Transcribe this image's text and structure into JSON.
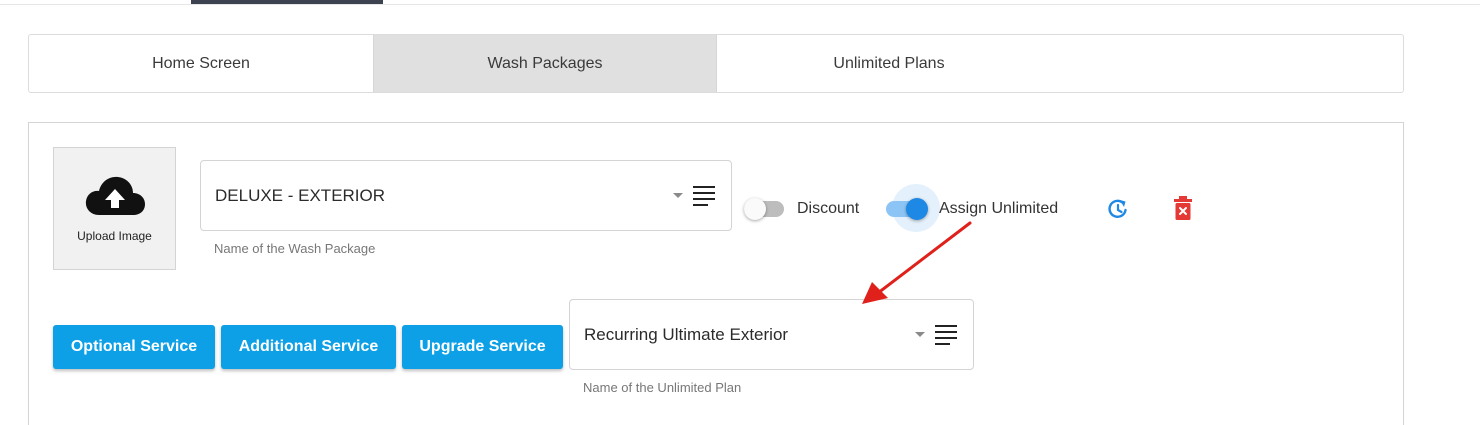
{
  "tabs": [
    {
      "label": "Home Screen",
      "active": false
    },
    {
      "label": "Wash Packages",
      "active": true
    },
    {
      "label": "Unlimited Plans",
      "active": false
    }
  ],
  "upload": {
    "label": "Upload Image",
    "icon": "cloud-upload-icon"
  },
  "wash_package": {
    "value": "DELUXE - EXTERIOR",
    "helper": "Name of the Wash Package"
  },
  "discount_toggle": {
    "label": "Discount",
    "on": false
  },
  "assign_unlimited_toggle": {
    "label": "Assign Unlimited",
    "on": true
  },
  "actions": {
    "history_icon": "history-icon",
    "delete_icon": "delete-icon"
  },
  "buttons": {
    "optional": "Optional Service",
    "additional": "Additional Service",
    "upgrade": "Upgrade Service"
  },
  "unlimited_plan": {
    "value": "Recurring Ultimate Exterior",
    "helper": "Name of the Unlimited Plan"
  },
  "colors": {
    "accent": "#0ea0e6",
    "toggle_on": "#1e88e5",
    "delete": "#e53935",
    "annotation": "#e0201a"
  }
}
